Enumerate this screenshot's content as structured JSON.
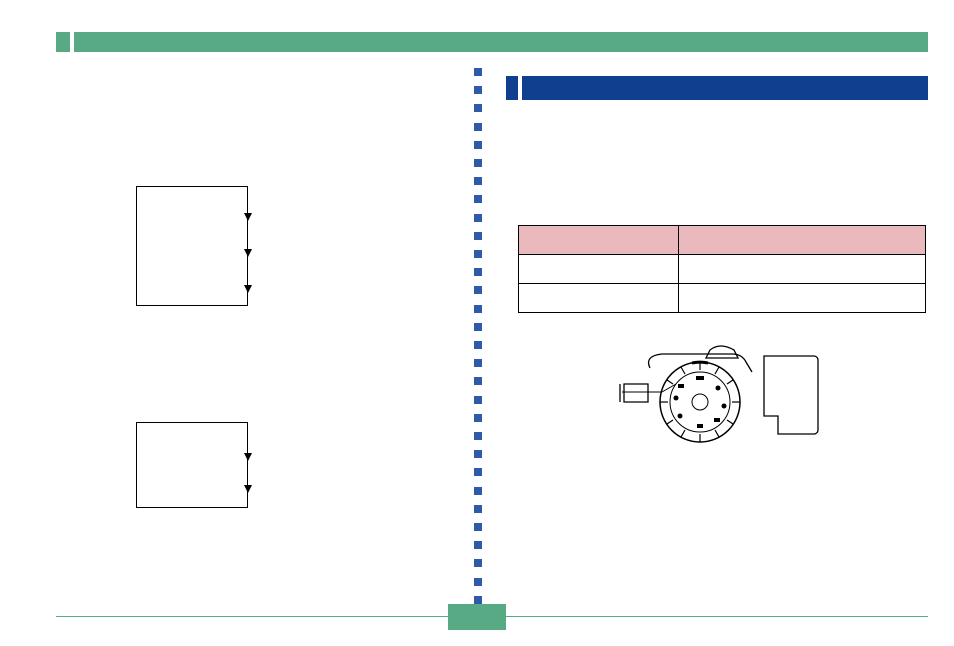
{
  "topBar": {
    "label": ""
  },
  "sectionHeader": {
    "label": ""
  },
  "leftColumn": {
    "flow1": {
      "steps": [
        "",
        "",
        "",
        ""
      ]
    },
    "flow2": {
      "steps": [
        "",
        "",
        ""
      ]
    }
  },
  "rightColumn": {
    "intro": "",
    "table": {
      "headers": [
        "",
        ""
      ],
      "rows": [
        [
          "",
          ""
        ],
        [
          "",
          ""
        ]
      ]
    },
    "illustration": {
      "name": "camera-mode-dial"
    }
  },
  "pageNumber": ""
}
